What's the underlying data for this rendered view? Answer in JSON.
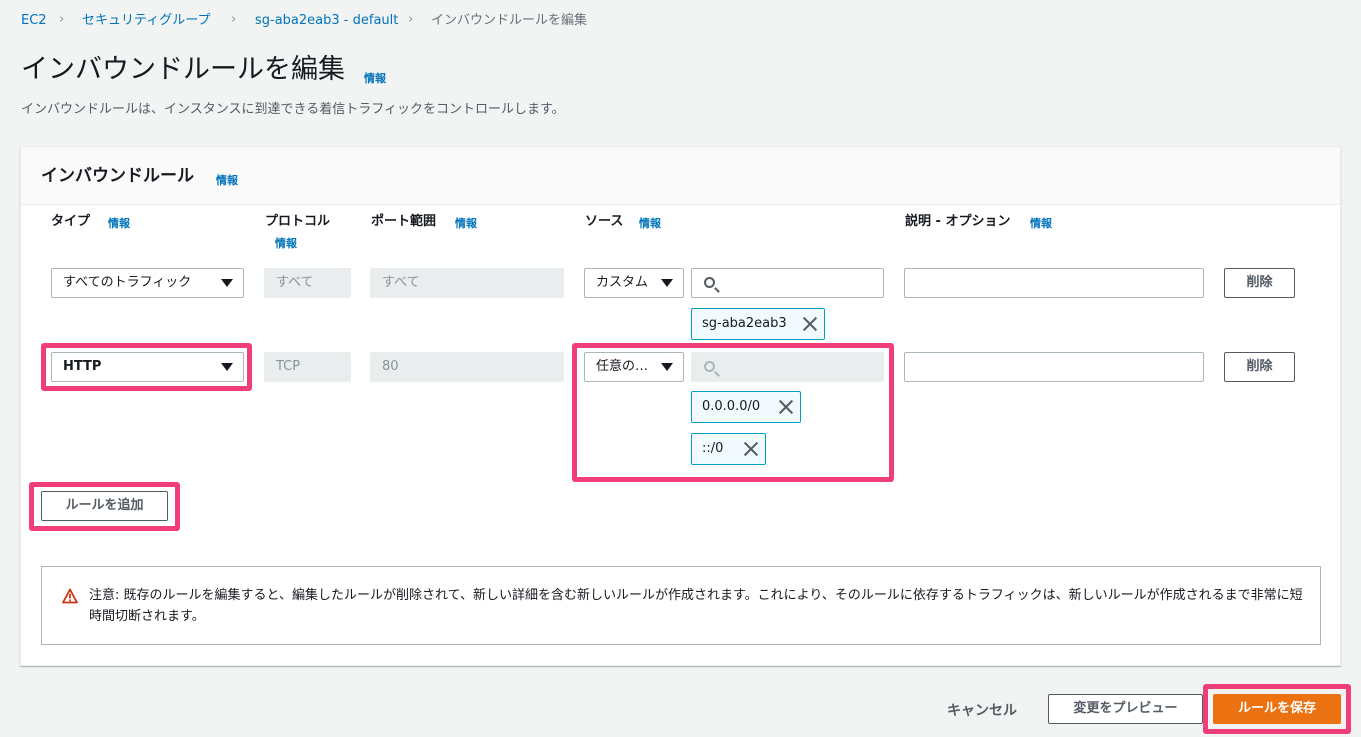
{
  "breadcrumb": {
    "items": [
      "EC2",
      "セキュリティグループ",
      "sg-aba2eab3 - default"
    ],
    "current": "インバウンドルールを編集"
  },
  "page": {
    "title": "インバウンドルールを編集",
    "info": "情報",
    "description": "インバウンドルールは、インスタンスに到達できる着信トラフィックをコントロールします。"
  },
  "panel": {
    "title": "インバウンドルール",
    "info": "情報",
    "columns": {
      "type": "タイプ",
      "protocol": "プロトコル",
      "port": "ポート範囲",
      "source": "ソース",
      "description": "説明 - オプション",
      "info": "情報"
    }
  },
  "rules": [
    {
      "type": "すべてのトラフィック",
      "protocol": "すべて",
      "port": "すべて",
      "source_mode": "カスタム",
      "tokens": [
        "sg-aba2eab3"
      ],
      "delete": "削除"
    },
    {
      "type": "HTTP",
      "protocol": "TCP",
      "port": "80",
      "source_mode": "任意の…",
      "tokens": [
        "0.0.0.0/0",
        "::/0"
      ],
      "delete": "削除"
    }
  ],
  "add_rule": "ルールを追加",
  "alert": {
    "text": "注意: 既存のルールを編集すると、編集したルールが削除されて、新しい詳細を含む新しいルールが作成されます。これにより、そのルールに依存するトラフィックは、新しいルールが作成されるまで非常に短時間切断されます。"
  },
  "footer": {
    "cancel": "キャンセル",
    "preview": "変更をプレビュー",
    "save": "ルールを保存"
  },
  "colors": {
    "link": "#0073bb",
    "primary": "#ec7211",
    "highlight": "#f03e79",
    "token_border": "#00a1c9"
  }
}
